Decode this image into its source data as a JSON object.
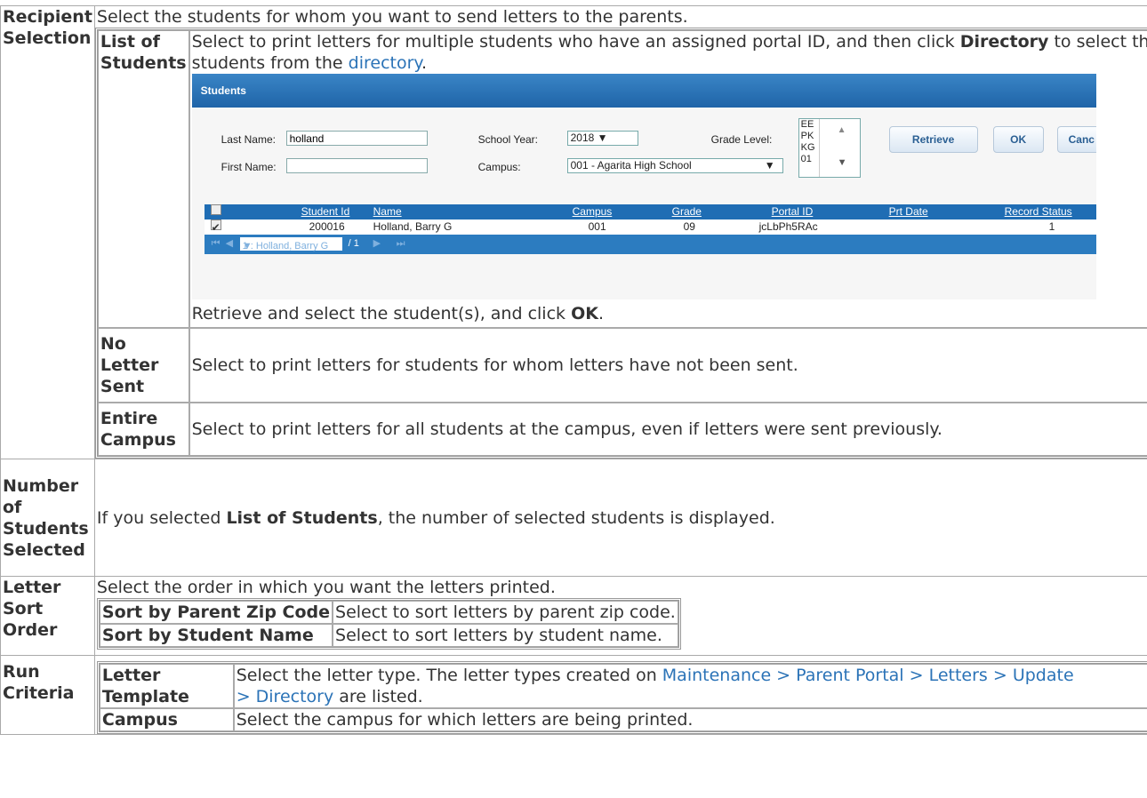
{
  "rows": {
    "recipient": {
      "label": "Recipient Selection",
      "desc": "Select the students for whom you want to send letters to the parents.",
      "list_of_students": {
        "label": "List of Students",
        "desc_pre": "Select to print letters for multiple students who have an assigned portal ID, and then click ",
        "desc_bold": "Directory",
        "desc_mid": " to select the students from the ",
        "desc_link": "directory",
        "desc_end": ".",
        "after_pre": "Retrieve and select the student(s), and click ",
        "after_bold": "OK",
        "after_end": "."
      },
      "no_letter_sent": {
        "label": "No Letter Sent",
        "desc": "Select to print letters for students for whom letters have not been sent."
      },
      "entire_campus": {
        "label": "Entire Campus",
        "desc": "Select to print letters for all students at the campus, even if letters were sent previously."
      }
    },
    "number_selected": {
      "label": "Number of Students Selected",
      "desc_pre": "If you selected ",
      "desc_bold": "List of Students",
      "desc_end": ", the number of selected students is displayed."
    },
    "sort_order": {
      "label": "Letter Sort Order",
      "desc": "Select the order in which you want the letters printed.",
      "options": [
        {
          "label": "Sort by Parent Zip Code",
          "desc": "Select to sort letters by parent zip code."
        },
        {
          "label": "Sort by Student Name",
          "desc": "Select to sort letters by student name."
        }
      ]
    },
    "run_criteria": {
      "label": "Run Criteria",
      "letter_template": {
        "label": "Letter Template",
        "desc_pre": "Select the letter type. The letter types created on ",
        "desc_link": "Maintenance > Parent Portal > Letters > Update > Directory",
        "desc_end": " are listed."
      },
      "campus": {
        "label": "Campus",
        "desc": "Select the campus for which letters are being printed."
      }
    }
  },
  "screenshot": {
    "title": "Students",
    "last_name_label": "Last Name:",
    "last_name_value": "holland",
    "first_name_label": "First Name:",
    "first_name_value": "",
    "school_year_label": "School Year:",
    "school_year_value": "2018",
    "campus_label": "Campus:",
    "campus_value": "001 - Agarita High School",
    "grade_level_label": "Grade Level:",
    "grade_levels": [
      "EE",
      "PK",
      "KG",
      "01"
    ],
    "retrieve_label": "Retrieve",
    "ok_label": "OK",
    "cancel_label": "Canc",
    "columns": [
      "Student Id",
      "Name",
      "Campus",
      "Grade",
      "Portal ID",
      "Prt Date",
      "Record Status"
    ],
    "row": {
      "student_id": "200016",
      "name": "Holland, Barry G",
      "campus": "001",
      "grade": "09",
      "portal_id": "jcLbPh5RAc",
      "prt_date": "",
      "record_status": "1"
    },
    "pager_select": "1 : Holland, Barry G",
    "pager_total": "/ 1"
  }
}
